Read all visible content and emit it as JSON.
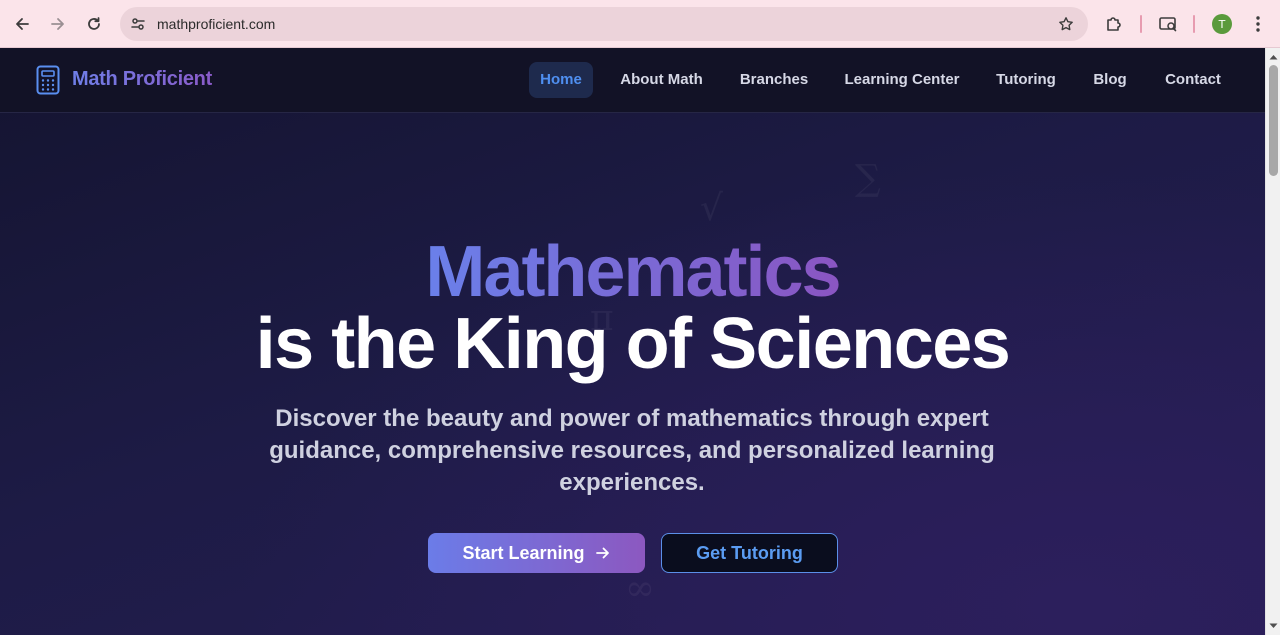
{
  "browser": {
    "url": "mathproficient.com",
    "profile_initial": "T",
    "icons": [
      "back-icon",
      "forward-icon",
      "reload-icon",
      "site-settings-icon",
      "bookmark-star-icon",
      "extensions-icon",
      "cast-search-icon",
      "menu-kebab-icon"
    ]
  },
  "site": {
    "logo_text": "Math Proficient",
    "logo_icon": "calculator-icon",
    "nav": [
      {
        "label": "Home",
        "active": true
      },
      {
        "label": "About Math",
        "active": false
      },
      {
        "label": "Branches",
        "active": false
      },
      {
        "label": "Learning Center",
        "active": false
      },
      {
        "label": "Tutoring",
        "active": false
      },
      {
        "label": "Blog",
        "active": false
      },
      {
        "label": "Contact",
        "active": false
      }
    ]
  },
  "hero": {
    "title_highlight": "Mathematics",
    "title_rest": "is the King of Sciences",
    "subtitle": "Discover the beauty and power of mathematics through expert guidance, comprehensive resources, and personalized learning experiences.",
    "primary_button": "Start Learning",
    "primary_button_icon": "arrow-right-icon",
    "secondary_button": "Get Tutoring"
  },
  "colors": {
    "accent_blue": "#4f8ff0",
    "gradient_start": "#6b7ce8",
    "gradient_end": "#8c58c0",
    "background": "#1d1b45"
  }
}
